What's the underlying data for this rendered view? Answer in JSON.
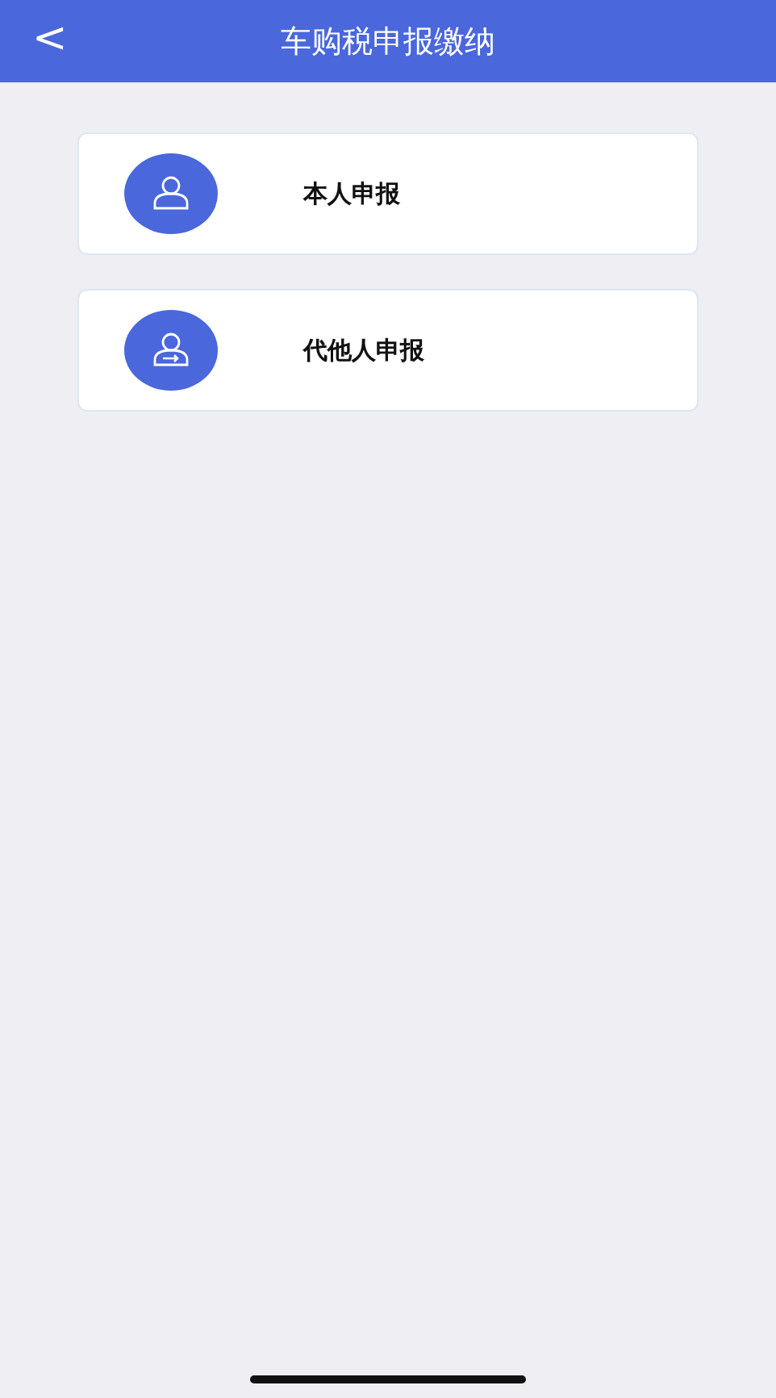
{
  "header": {
    "back": "<",
    "title": "车购税申报缴纳"
  },
  "options": [
    {
      "kind": "self",
      "label": "本人申报"
    },
    {
      "kind": "proxy",
      "label": "代他人申报"
    }
  ]
}
